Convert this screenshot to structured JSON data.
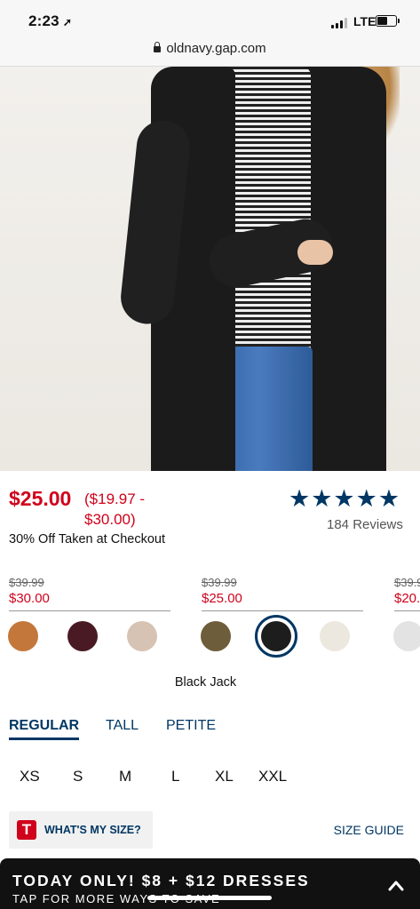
{
  "status_bar": {
    "time": "2:23",
    "network": "LTE",
    "battery_level": 0.6
  },
  "browser": {
    "url": "oldnavy.gap.com"
  },
  "gallery": {
    "position_fraction": 0.145
  },
  "product": {
    "price": "$25.00",
    "range_line1": "($19.97 -",
    "range_line2": "$30.00)",
    "offer": "30% Off Taken at Checkout",
    "rating_stars": "★★★★★",
    "reviews": "184 Reviews"
  },
  "swatch_groups": [
    {
      "old": "$39.99",
      "new": "$30.00"
    },
    {
      "old": "$39.99",
      "new": "$25.00"
    },
    {
      "old": "$39.9",
      "new": "$20."
    }
  ],
  "swatches": [
    {
      "color": "#c4773b"
    },
    {
      "color": "#4a1a24"
    },
    {
      "color": "#d7c3b4"
    },
    {
      "color": "#6e5d3a"
    },
    {
      "color": "#1d1d1d",
      "selected": true
    },
    {
      "color": "#ece8df"
    },
    {
      "color": "#e3e3e3"
    }
  ],
  "selected_color_name": "Black Jack",
  "fit_tabs": [
    "REGULAR",
    "TALL",
    "PETITE"
  ],
  "sizes": [
    "XS",
    "S",
    "M",
    "L",
    "XL",
    "XXL"
  ],
  "size_help": {
    "icon_letter": "T",
    "label": "WHAT'S MY SIZE?",
    "guide": "SIZE GUIDE"
  },
  "promo_banner": {
    "title": "TODAY ONLY! $8 + $12 DRESSES",
    "subtitle": "TAP FOR MORE WAYS TO SAVE"
  },
  "colors": {
    "brand_navy": "#003764",
    "sale_red": "#d0021b"
  }
}
